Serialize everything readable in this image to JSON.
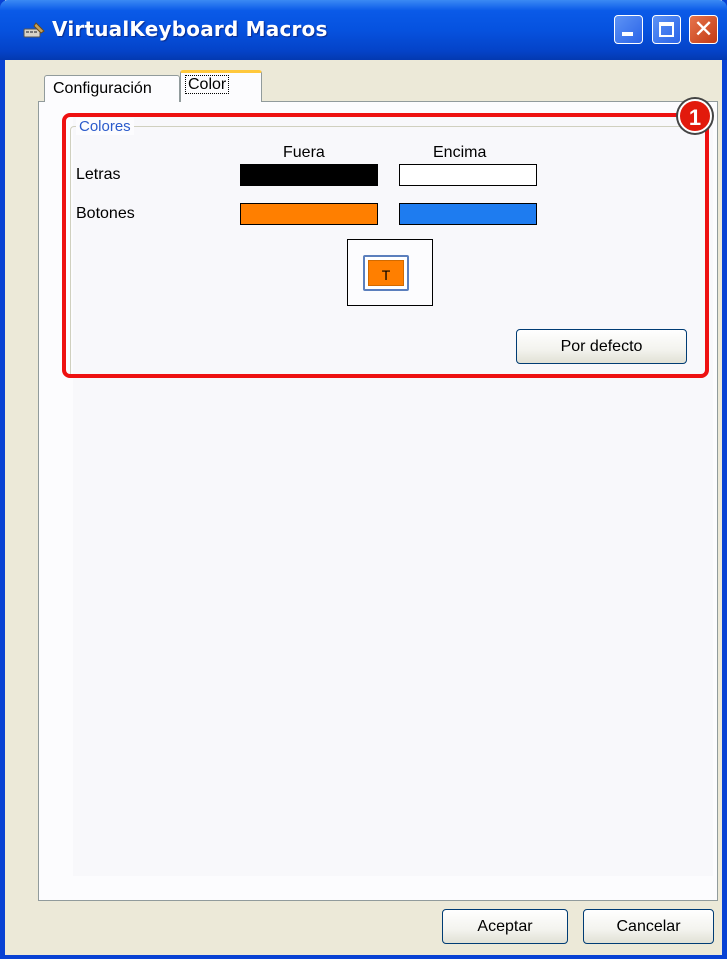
{
  "window": {
    "title": "VirtualKeyboard Macros"
  },
  "tabs": [
    {
      "label": "Configuración"
    },
    {
      "label": "Color"
    }
  ],
  "group": {
    "label": "Colores",
    "col_outside": "Fuera",
    "col_over": "Encima",
    "rows": [
      {
        "label": "Letras",
        "outside_color": "#000000",
        "over_color": "#ffffff"
      },
      {
        "label": "Botones",
        "outside_color": "#ff7f00",
        "over_color": "#1e7cf0"
      }
    ],
    "preview_text": "T",
    "default_button": "Por defecto"
  },
  "annotation": {
    "number": "1",
    "color": "#ee1111"
  },
  "footer": {
    "accept": "Aceptar",
    "cancel": "Cancelar"
  },
  "icons": [
    "app-icon",
    "minimize-icon",
    "maximize-icon",
    "close-icon"
  ]
}
